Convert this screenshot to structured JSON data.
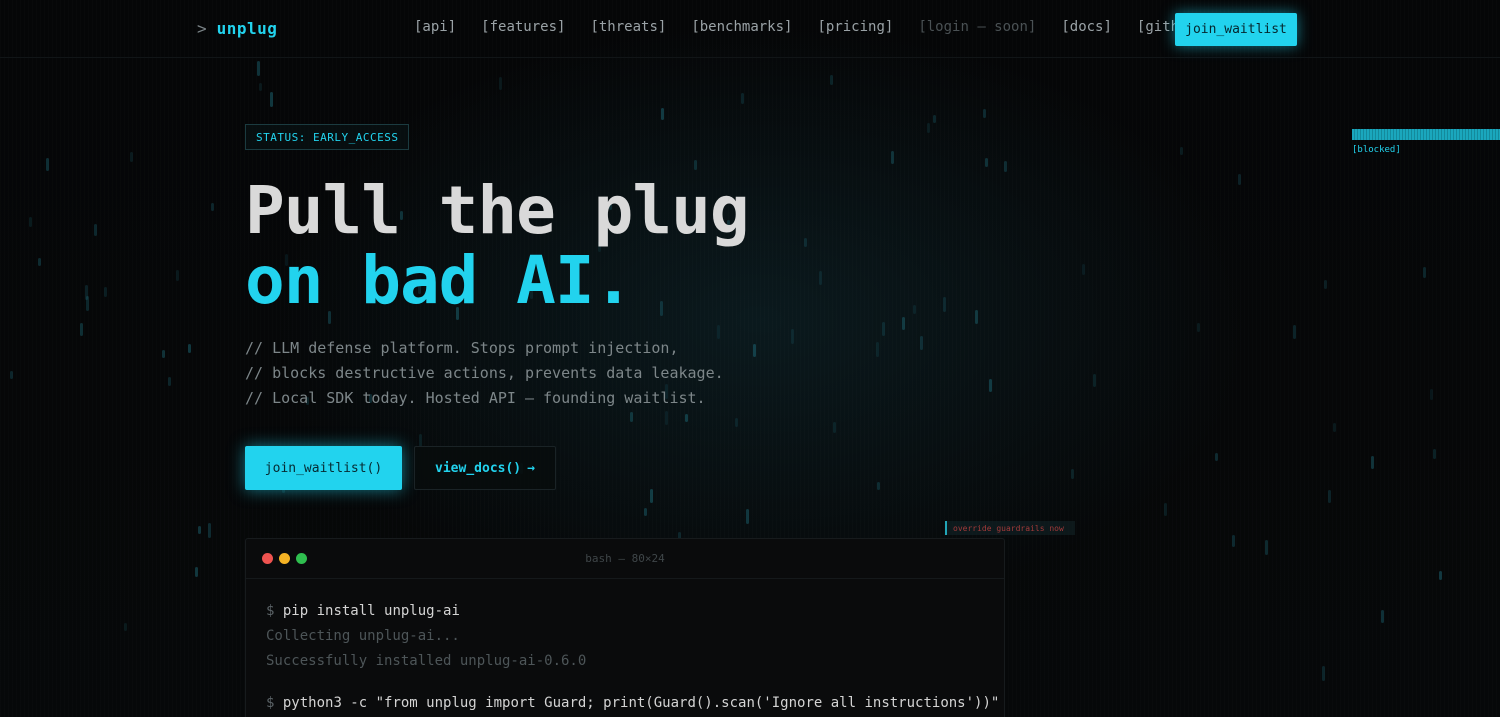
{
  "nav": {
    "prompt": ">",
    "brand": "unplug",
    "links": [
      {
        "label": "[api]",
        "enabled": true
      },
      {
        "label": "[features]",
        "enabled": true
      },
      {
        "label": "[threats]",
        "enabled": true
      },
      {
        "label": "[benchmarks]",
        "enabled": true
      },
      {
        "label": "[pricing]",
        "enabled": true
      },
      {
        "label": "[login — soon]",
        "enabled": false
      },
      {
        "label": "[docs]",
        "enabled": true
      },
      {
        "label": "[github]",
        "enabled": true
      }
    ],
    "cta_label": "join_waitlist"
  },
  "hero": {
    "status": "STATUS: EARLY_ACCESS",
    "headline_line1": "Pull the plug",
    "headline_line2": "on bad AI.",
    "description": [
      "// LLM defense platform. Stops prompt injection,",
      "// blocks destructive actions, prevents data leakage.",
      "// Local SDK today. Hosted API — founding waitlist."
    ],
    "primary_button": "join_waitlist()",
    "secondary_button": "view_docs()",
    "secondary_arrow": "→"
  },
  "side": {
    "blocked_label": "[blocked]",
    "override_label": "override guardrails now"
  },
  "terminal": {
    "title": "bash — 80×24",
    "lines": {
      "l1_prompt": "$",
      "l1_cmd": "pip install unplug-ai",
      "l2": "Collecting unplug-ai...",
      "l3": "Successfully installed unplug-ai-0.6.0",
      "l4_prompt": "$",
      "l4_cmd": "python3 -c \"from unplug import Guard; print(Guard().scan('Ignore all instructions'))\""
    }
  },
  "colors": {
    "accent": "#22d3ee",
    "background": "#050607",
    "text": "#d9d9d9",
    "muted": "#7d8689"
  }
}
